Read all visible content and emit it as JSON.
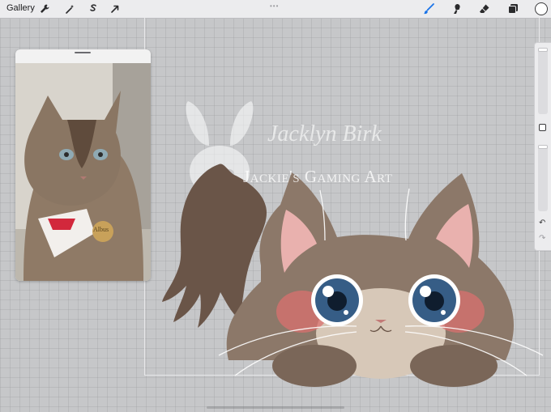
{
  "toolbar": {
    "gallery_label": "Gallery",
    "left_tools": [
      "wrench-icon",
      "magic-wand-icon",
      "selection-icon",
      "transform-arrow-icon"
    ],
    "right_tools": [
      "brush-icon",
      "smudge-icon",
      "eraser-icon",
      "layers-icon",
      "color-swatch"
    ],
    "active_tool": "brush-icon",
    "active_color": "#ffffff",
    "accent_color": "#1a74e8"
  },
  "watermark": {
    "signature": "Jacklyn Birk",
    "studio_name": "Jackie's Gaming Art"
  },
  "reference_photo": {
    "tag_text": "Albus"
  },
  "sidebar": {
    "buttons": [
      "brush-size-slider",
      "modify-button",
      "opacity-slider",
      "undo-icon",
      "redo-icon"
    ]
  }
}
